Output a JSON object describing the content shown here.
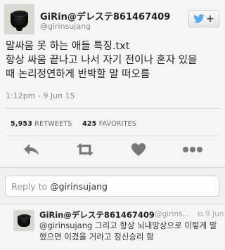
{
  "tweet": {
    "name": "GiRin@デレステ861467409",
    "handle": "@girinsujang",
    "text_lines": [
      "말싸움 못 하는 애들 특징.txt",
      "항상 싸움 끝나고 나서 자기 전이나 혼자 있을",
      "때 논리정연하게 반박할 말 떠오름"
    ],
    "timestamp": "1:12pm - 9 Jun 15",
    "retweets_count": "5,953",
    "retweets_label": "RETWEETS",
    "favorites_count": "425",
    "favorites_label": "FAVORITES"
  },
  "follow_button": {
    "plus": "+"
  },
  "reply_box": {
    "prefix": "Reply to ",
    "mention": "@girinsujang"
  },
  "reply": {
    "name": "GiRin@デレステ861467409",
    "handle": "@girins...",
    "time": "9 Jun",
    "text_mention": "@girinsujang",
    "text_line1_rest": " 그리고 항상 뇌내망상으로 이렇게 말",
    "text_line2": "했으면 이겼을 거라고 정신승리 함"
  },
  "icons": [
    "twitter-bird-icon",
    "reply-icon",
    "retweet-icon",
    "favorite-icon",
    "more-icon",
    "retweet-small-icon"
  ],
  "colors": {
    "icon_gray": "#777777",
    "bird_blue": "#55acee",
    "background": "#f5f5f5"
  }
}
